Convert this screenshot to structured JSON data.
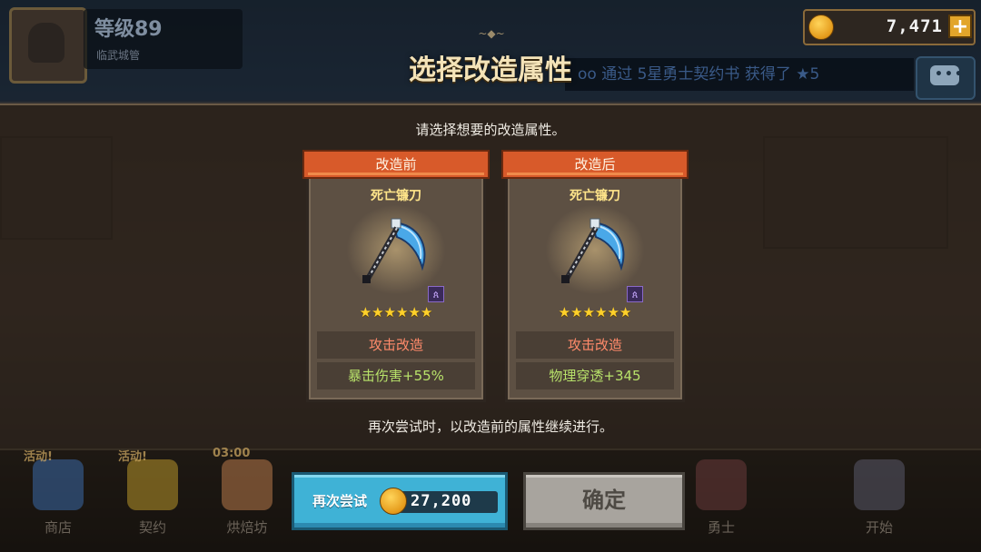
{
  "player": {
    "level": "等级89",
    "title": "临武城管"
  },
  "currency": {
    "gold": "7,471",
    "plus": "+"
  },
  "ticker": {
    "text": "oo 通过 5星勇士契约书 获得了 ★5"
  },
  "dialog": {
    "ornament": "~◆~",
    "title": "选择改造属性",
    "instruction": "请选择想要的改造属性。",
    "footnote": "再次尝试时，以改造前的属性继续进行。"
  },
  "cards": [
    {
      "header": "改造前",
      "weapon_name": "死亡镰刀",
      "stars": "★★★★★★",
      "star_count": 6,
      "rune": "ጰ",
      "stat_type": "攻击改造",
      "stat_value": "暴击伤害+55%"
    },
    {
      "header": "改造后",
      "weapon_name": "死亡镰刀",
      "stars": "★★★★★★",
      "star_count": 6,
      "rune": "ጰ",
      "stat_type": "攻击改造",
      "stat_value": "物理穿透+345"
    }
  ],
  "buttons": {
    "retry_label": "再次尝试",
    "retry_cost": "27,200",
    "confirm_label": "确定"
  },
  "nav": {
    "shop": {
      "label": "商店",
      "badge": "活动!"
    },
    "contract": {
      "label": "契约",
      "badge": "活动!"
    },
    "bakery": {
      "label": "烘焙坊",
      "badge": "03:00"
    },
    "hero": {
      "label": "勇士"
    },
    "start": {
      "label": "开始"
    }
  },
  "colors": {
    "accent_ribbon": "#d85a2a",
    "retry_button": "#3fb2d6",
    "confirm_button": "#a8a49e",
    "stat_type": "#ff8a6a",
    "stat_value": "#b8e26a",
    "weapon_name": "#ffe58a"
  },
  "icons": {
    "coin": "gold-coin-icon",
    "chat": "chat-bubble-icon",
    "weapon": "scythe-icon",
    "rune": "rune-icon"
  }
}
